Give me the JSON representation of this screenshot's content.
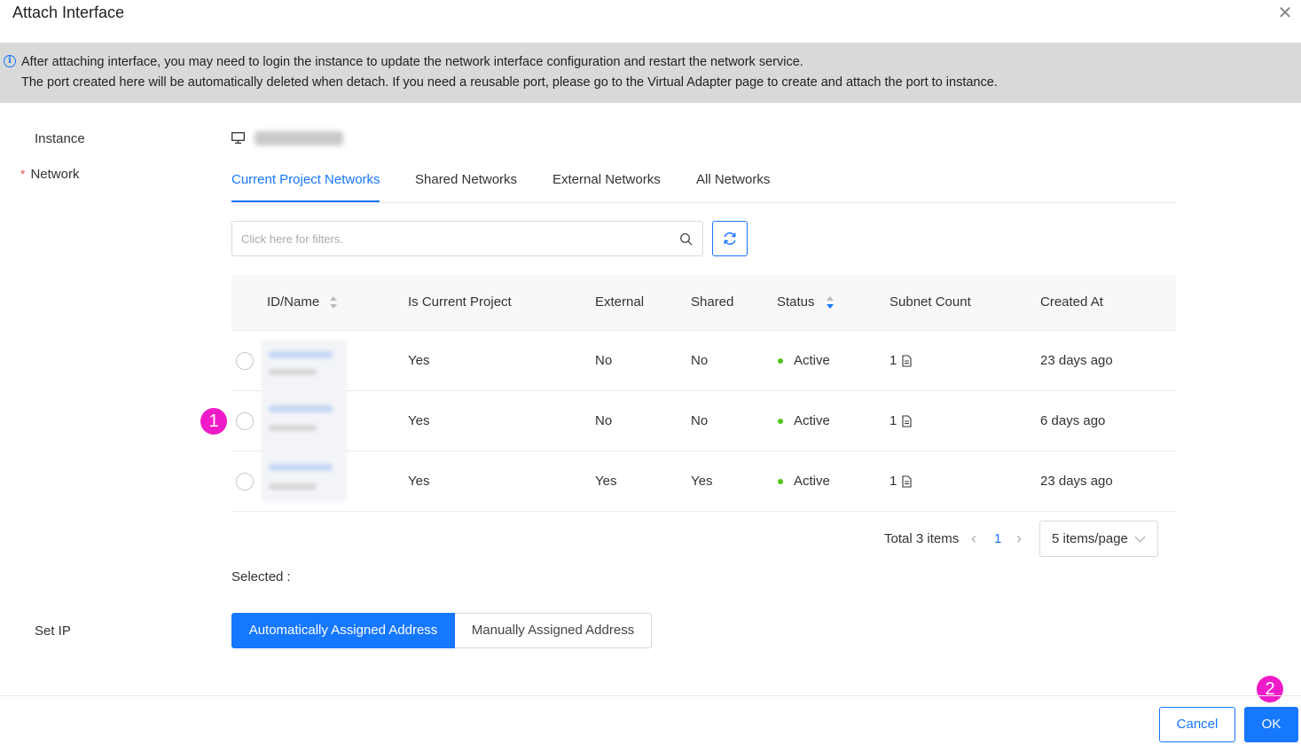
{
  "dialog": {
    "title": "Attach Interface",
    "close_icon": "close-icon"
  },
  "notice": {
    "icon": "info-icon",
    "line1": "After attaching interface, you may need to login the instance to update the network interface configuration and restart the network service.",
    "line2": "The port created here will be automatically deleted when detach. If you need a reusable port, please go to the Virtual Adapter page to create and attach the port to instance."
  },
  "form": {
    "instance_label": "Instance",
    "instance_icon": "monitor-icon",
    "network_label": "Network",
    "network_required_mark": "*",
    "selected_label": "Selected :",
    "set_ip_label": "Set IP"
  },
  "tabs": [
    {
      "label": "Current Project Networks",
      "active": true
    },
    {
      "label": "Shared Networks",
      "active": false
    },
    {
      "label": "External Networks",
      "active": false
    },
    {
      "label": "All Networks",
      "active": false
    }
  ],
  "search": {
    "placeholder": "Click here for filters."
  },
  "table": {
    "columns": [
      "ID/Name",
      "Is Current Project",
      "External",
      "Shared",
      "Status",
      "Subnet Count",
      "Created At"
    ],
    "rows": [
      {
        "is_current_project": "Yes",
        "external": "No",
        "shared": "No",
        "status": "Active",
        "subnet_count": "1",
        "created_at": "23 days ago"
      },
      {
        "is_current_project": "Yes",
        "external": "No",
        "shared": "No",
        "status": "Active",
        "subnet_count": "1",
        "created_at": "6 days ago"
      },
      {
        "is_current_project": "Yes",
        "external": "Yes",
        "shared": "Yes",
        "status": "Active",
        "subnet_count": "1",
        "created_at": "23 days ago"
      }
    ]
  },
  "pagination": {
    "total": "Total 3 items",
    "current_page": "1",
    "page_size": "5 items/page"
  },
  "ip_mode": {
    "options": [
      "Automatically Assigned Address",
      "Manually Assigned Address"
    ],
    "selected": "Automatically Assigned Address"
  },
  "markers": [
    "1",
    "2"
  ],
  "footer": {
    "cancel_label": "Cancel",
    "ok_label": "OK"
  },
  "colors": {
    "primary": "#1677ff",
    "status_active": "#52c41a",
    "marker": "#f01bc8",
    "notice_bg": "#d9d9d9"
  }
}
